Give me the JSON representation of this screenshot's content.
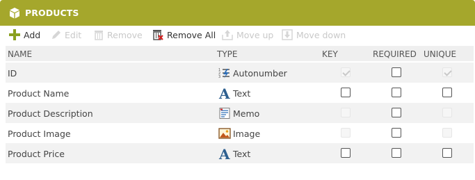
{
  "panel": {
    "title": "PRODUCTS",
    "accent": "#a5a72c",
    "icon": "box-icon"
  },
  "toolbar": {
    "add": "Add",
    "edit": "Edit",
    "remove": "Remove",
    "remove_all": "Remove All",
    "move_up": "Move up",
    "move_down": "Move down"
  },
  "columns": {
    "name": "NAME",
    "type": "TYPE",
    "key": "KEY",
    "required": "REQUIRED",
    "unique": "UNIQUE"
  },
  "rows": [
    {
      "name": "ID",
      "type": "Autonumber",
      "type_icon": "autonumber-icon",
      "key": true,
      "key_enabled": false,
      "required": false,
      "unique": true,
      "unique_enabled": false
    },
    {
      "name": "Product Name",
      "type": "Text",
      "type_icon": "text-icon",
      "key": false,
      "key_enabled": true,
      "required": false,
      "unique": false,
      "unique_enabled": true
    },
    {
      "name": "Product Description",
      "type": "Memo",
      "type_icon": "memo-icon",
      "key": false,
      "key_enabled": false,
      "required": false,
      "unique": false,
      "unique_enabled": false
    },
    {
      "name": "Product Image",
      "type": "Image",
      "type_icon": "image-icon",
      "key": false,
      "key_enabled": false,
      "required": false,
      "unique": false,
      "unique_enabled": false
    },
    {
      "name": "Product Price",
      "type": "Text",
      "type_icon": "text-icon",
      "key": false,
      "key_enabled": true,
      "required": false,
      "unique": false,
      "unique_enabled": true
    }
  ]
}
